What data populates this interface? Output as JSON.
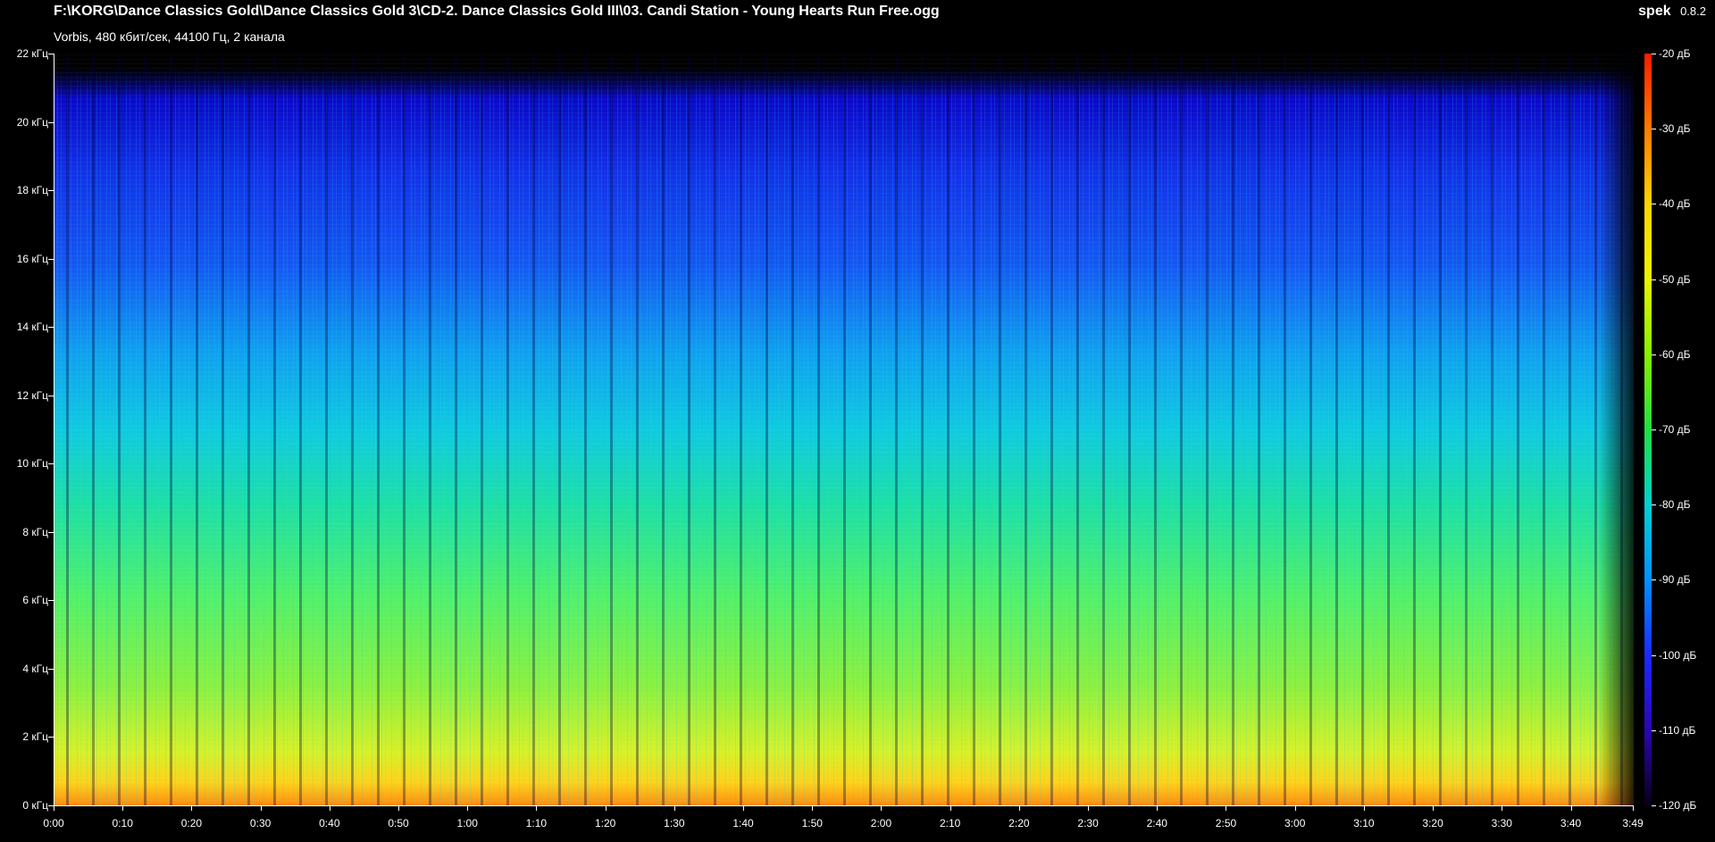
{
  "header": {
    "file_path": "F:\\KORG\\Dance Classics Gold\\Dance Classics Gold 3\\CD-2. Dance Classics Gold III\\03. Candi Station - Young Hearts Run Free.ogg",
    "audio_info": "Vorbis, 480 кбит/сек, 44100 Гц, 2 канала"
  },
  "brand": {
    "name": "spek",
    "version": "0.8.2"
  },
  "axes": {
    "frequency_labels": [
      "22 кГц",
      "20 кГц",
      "18 кГц",
      "16 кГц",
      "14 кГц",
      "12 кГц",
      "10 кГц",
      "8 кГц",
      "6 кГц",
      "4 кГц",
      "2 кГц",
      "0 кГц"
    ],
    "time_labels": [
      "0:00",
      "0:10",
      "0:20",
      "0:30",
      "0:40",
      "0:50",
      "1:00",
      "1:10",
      "1:20",
      "1:30",
      "1:40",
      "1:50",
      "2:00",
      "2:10",
      "2:20",
      "2:30",
      "2:40",
      "2:50",
      "3:00",
      "3:10",
      "3:20",
      "3:30",
      "3:40",
      "3:49"
    ],
    "db_labels": [
      "-20 дБ",
      "-30 дБ",
      "-40 дБ",
      "-50 дБ",
      "-60 дБ",
      "-70 дБ",
      "-80 дБ",
      "-90 дБ",
      "-100 дБ",
      "-110 дБ",
      "-120 дБ"
    ]
  },
  "colors": {
    "background": "#000000",
    "text": "#ffffff"
  }
}
